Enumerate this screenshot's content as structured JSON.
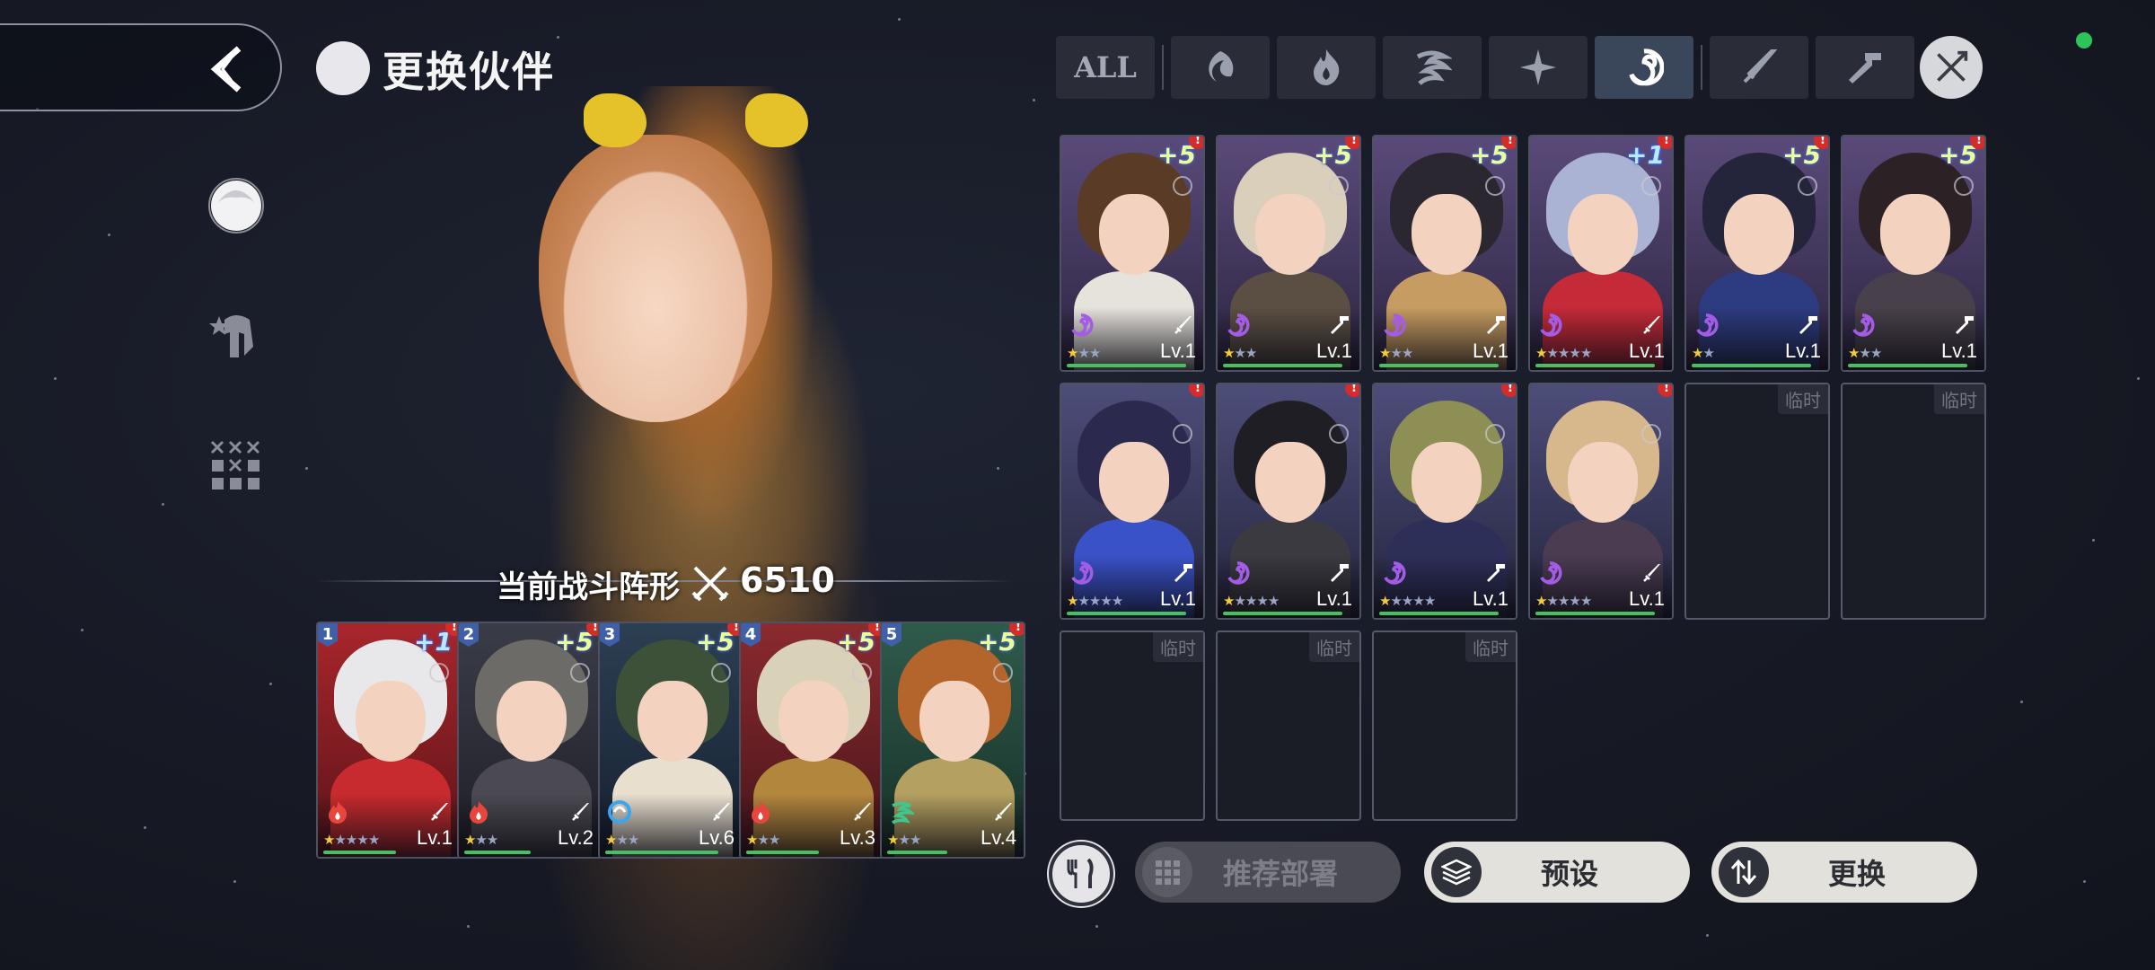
{
  "header": {
    "title": "更换伙伴"
  },
  "side_nav": [
    {
      "name": "partner",
      "active": true
    },
    {
      "name": "team-helmet",
      "active": false
    },
    {
      "name": "formation-grid",
      "active": false
    }
  ],
  "formation": {
    "label": "当前战斗阵形",
    "power": "6510"
  },
  "filters": {
    "all_label": "ALL",
    "items": [
      "water",
      "fire",
      "wind",
      "light",
      "dark",
      "sword",
      "hammer",
      "mixed"
    ],
    "active": "dark"
  },
  "team": [
    {
      "slot": "1",
      "plus": "+1",
      "element": "fire",
      "weapon": "sword",
      "stars": 1,
      "max_stars": 5,
      "level": "Lv.1",
      "exp": 0.55
    },
    {
      "slot": "2",
      "plus": "+5",
      "element": "fire",
      "weapon": "sword",
      "stars": 1,
      "max_stars": 3,
      "level": "Lv.2",
      "exp": 0.5
    },
    {
      "slot": "3",
      "plus": "+5",
      "element": "water",
      "weapon": "sword",
      "stars": 1,
      "max_stars": 3,
      "level": "Lv.6",
      "exp": 0.85
    },
    {
      "slot": "4",
      "plus": "+5",
      "element": "fire",
      "weapon": "sword",
      "stars": 1,
      "max_stars": 3,
      "level": "Lv.3",
      "exp": 0.55
    },
    {
      "slot": "5",
      "plus": "+5",
      "element": "wind",
      "weapon": "sword",
      "stars": 1,
      "max_stars": 3,
      "level": "Lv.4",
      "exp": 0.45
    }
  ],
  "roster": [
    {
      "plus": "+5",
      "element": "dark",
      "weapon": "sword",
      "stars": 1,
      "max_stars": 3,
      "level": "Lv.1",
      "exp": 0.9
    },
    {
      "plus": "+5",
      "element": "dark",
      "weapon": "hammer",
      "stars": 1,
      "max_stars": 3,
      "level": "Lv.1",
      "exp": 0.9
    },
    {
      "plus": "+5",
      "element": "dark",
      "weapon": "hammer",
      "stars": 1,
      "max_stars": 3,
      "level": "Lv.1",
      "exp": 0.9
    },
    {
      "plus": "+1",
      "element": "dark",
      "weapon": "sword",
      "stars": 1,
      "max_stars": 5,
      "level": "Lv.1",
      "exp": 0.9
    },
    {
      "plus": "+5",
      "element": "dark",
      "weapon": "hammer",
      "stars": 1,
      "max_stars": 2,
      "level": "Lv.1",
      "exp": 0.9
    },
    {
      "plus": "+5",
      "element": "dark",
      "weapon": "hammer",
      "stars": 1,
      "max_stars": 3,
      "level": "Lv.1",
      "exp": 0.9
    },
    {
      "plus": "",
      "element": "dark",
      "weapon": "hammer",
      "stars": 1,
      "max_stars": 5,
      "level": "Lv.1",
      "exp": 0.9
    },
    {
      "plus": "",
      "element": "dark",
      "weapon": "hammer",
      "stars": 1,
      "max_stars": 5,
      "level": "Lv.1",
      "exp": 0.9
    },
    {
      "plus": "",
      "element": "dark",
      "weapon": "hammer",
      "stars": 1,
      "max_stars": 5,
      "level": "Lv.1",
      "exp": 0.9
    },
    {
      "plus": "",
      "element": "dark",
      "weapon": "sword",
      "stars": 1,
      "max_stars": 5,
      "level": "Lv.1",
      "exp": 0.9
    }
  ],
  "empty_slots": {
    "label": "临时",
    "count": 5
  },
  "actions": {
    "recommend_label": "推荐部署",
    "preset_label": "预设",
    "swap_label": "更换"
  },
  "colors": {
    "accent_green": "#2ec45c",
    "alert_red": "#d42b2b",
    "exp_bar": "#44c262"
  }
}
